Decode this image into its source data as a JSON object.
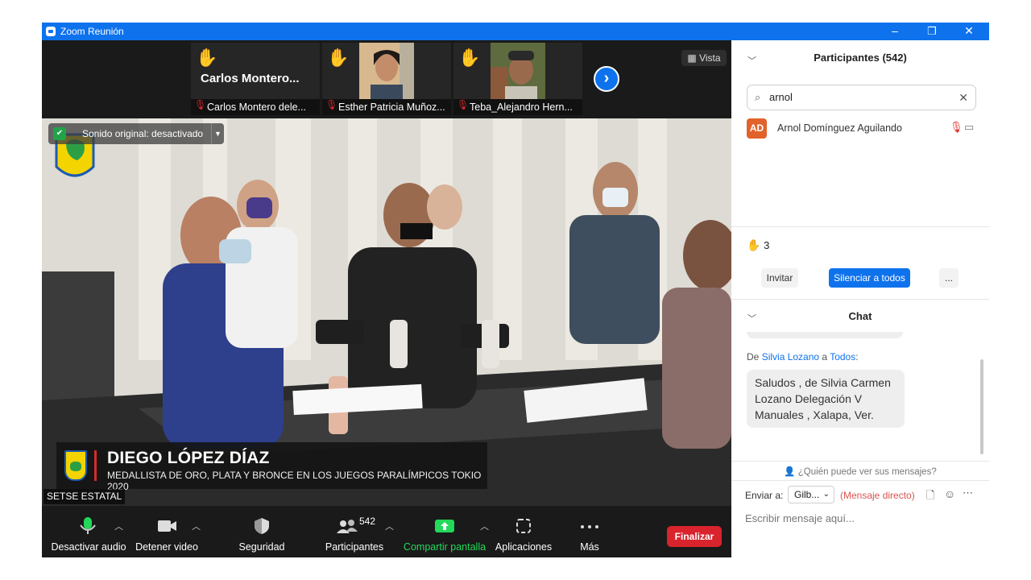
{
  "window": {
    "title": "Zoom Reunión",
    "minimize_icon": "–",
    "restore_icon": "❐",
    "close_icon": "✕"
  },
  "strip": {
    "tiles": [
      {
        "big_name": "Carlos  Montero...",
        "caption": "Carlos Montero dele...",
        "has_video": false
      },
      {
        "caption": "Esther Patricia Muñoz...",
        "has_video": true
      },
      {
        "caption": "Teba_Alejandro Hern...",
        "has_video": true
      }
    ],
    "next_icon": "›",
    "vista_label": "Vista"
  },
  "main_video": {
    "sound_pill": "Sonido original: desactivado",
    "lower_third_name": "DIEGO LÓPEZ DÍAZ",
    "lower_third_sub": "MEDALLISTA DE ORO, PLATA Y BRONCE EN LOS JUEGOS PARALÍMPICOS TOKIO 2020",
    "speaker_tag": "SETSE ESTATAL"
  },
  "toolbar": {
    "mute_label": "Desactivar audio",
    "video_label": "Detener video",
    "security_label": "Seguridad",
    "participants_label": "Participantes",
    "participants_count": "542",
    "share_label": "Compartir pantalla",
    "apps_label": "Aplicaciones",
    "more_label": "Más",
    "end_label": "Finalizar",
    "colors": {
      "share": "#23d959",
      "end": "#d9232d"
    }
  },
  "panel": {
    "participants_title": "Participantes (542)",
    "search_value": "arnol",
    "participant": {
      "initials": "AD",
      "name": "Arnol Domínguez Aguilando"
    },
    "raised_hands": "3",
    "invite_label": "Invitar",
    "mute_all_label": "Silenciar a todos",
    "more_label": "...",
    "chat_title": "Chat",
    "chat_from_prefix": "De ",
    "chat_from_name": "Silvia Lozano",
    "chat_from_mid": " a ",
    "chat_to": "Todos",
    "chat_from_suffix": ":",
    "chat_message": "Saludos , de Silvia Carmen Lozano Delegación V Manuales , Xalapa, Ver.",
    "who_can_see": "¿Quién puede ver sus mensajes?",
    "send_to_label": "Enviar a:",
    "send_to_value": "Gilb...",
    "direct_label": "(Mensaje directo)",
    "input_placeholder": "Escribir mensaje aquí..."
  }
}
